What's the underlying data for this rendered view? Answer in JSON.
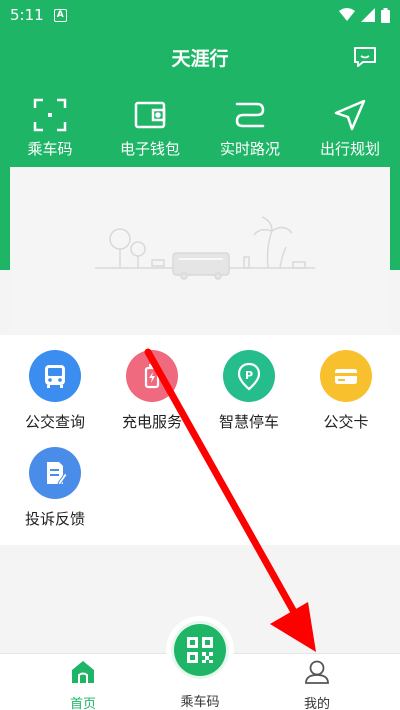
{
  "statusbar": {
    "time": "5:11",
    "notif_glyph": "A"
  },
  "header": {
    "title": "天涯行"
  },
  "quick_actions": [
    {
      "label": "乘车码",
      "icon": "scan-icon"
    },
    {
      "label": "电子钱包",
      "icon": "wallet-icon"
    },
    {
      "label": "实时路况",
      "icon": "route-icon"
    },
    {
      "label": "出行规划",
      "icon": "navigation-icon"
    }
  ],
  "services": [
    {
      "label": "公交查询",
      "icon": "bus-icon",
      "color": "#3b8df0"
    },
    {
      "label": "充电服务",
      "icon": "charging-icon",
      "color": "#ef6a7e"
    },
    {
      "label": "智慧停车",
      "icon": "parking-icon",
      "color": "#25bd8c"
    },
    {
      "label": "公交卡",
      "icon": "card-icon",
      "color": "#f9c02d"
    },
    {
      "label": "投诉反馈",
      "icon": "feedback-icon",
      "color": "#4a8de8"
    }
  ],
  "bottom_nav": [
    {
      "label": "首页",
      "active": true
    },
    {
      "label": "乘车码",
      "active": false
    },
    {
      "label": "我的",
      "active": false
    }
  ],
  "colors": {
    "primary": "#1fb566",
    "arrow": "#ff0000"
  }
}
